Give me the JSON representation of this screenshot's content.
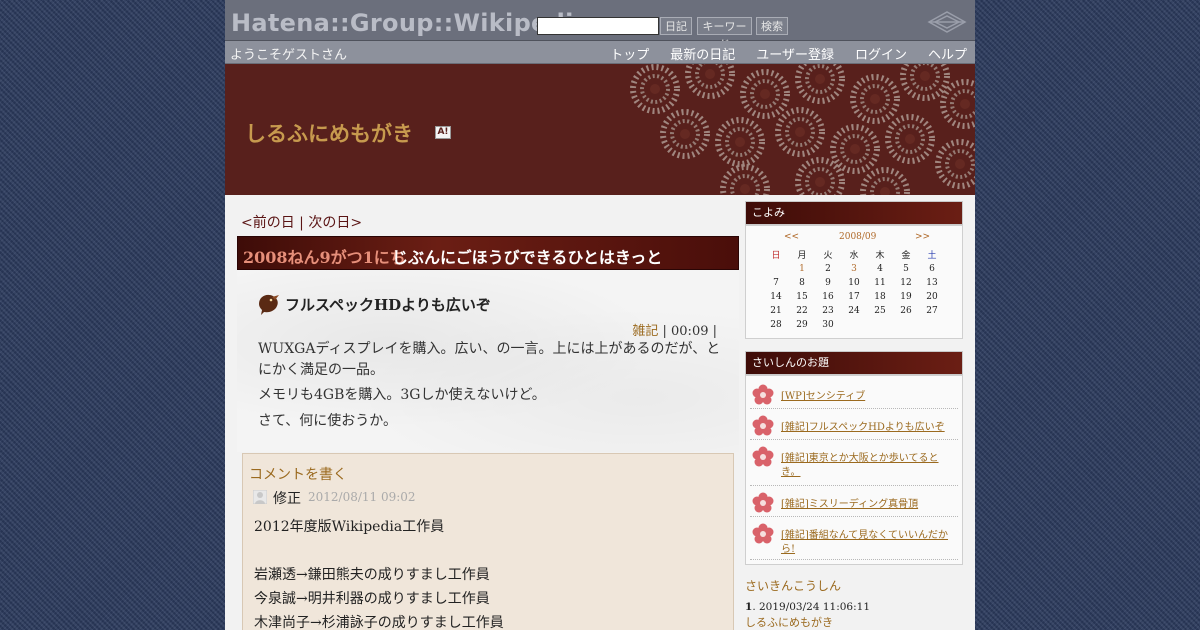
{
  "hatena": {
    "logo": "Hatena::Group::Wikipedia",
    "search_value": "",
    "btn_diary": "日記",
    "btn_keyword": "キーワード",
    "btn_search": "検索"
  },
  "nav": {
    "welcome": "ようこそゲストさん",
    "links": [
      "トップ",
      "最新の日記",
      "ユーザー登録",
      "ログイン",
      "ヘルプ"
    ]
  },
  "blog": {
    "title": "しるふにめもがき",
    "badge": "A!"
  },
  "daynav": {
    "prev": "<前の日",
    "sep": " | ",
    "next": "次の日>"
  },
  "day": {
    "date": "2008ねん9がつ1にち",
    "title": "じぶんにごほうびできるひとはきっと"
  },
  "section": {
    "title": "フルスペックHDよりも広いぞ",
    "category": "雑記",
    "time": " | 00:09 |",
    "paragraphs": [
      "WUXGAディスプレイを購入。広い、の一言。上には上があるのだが、とにかく満足の一品。",
      "メモリも4GBを購入。3Gしか使えないけど。",
      "さて、何に使おうか。"
    ]
  },
  "comments": {
    "write_label": "コメントを書く",
    "author": "修正",
    "time": "2012/08/11 09:02",
    "lines": [
      "2012年度版Wikipedia工作員",
      "岩瀬透→鎌田熊夫の成りすまし工作員",
      "今泉誠→明井利器の成りすまし工作員",
      "木津尚子→杉浦詠子の成りすまし工作員"
    ]
  },
  "calendar": {
    "heading": "こよみ",
    "prev": "<<",
    "month": "2008/09",
    "next": ">>",
    "weekdays": [
      "日",
      "月",
      "火",
      "水",
      "木",
      "金",
      "土"
    ],
    "weeks": [
      [
        "",
        "1",
        "2",
        "3",
        "4",
        "5",
        "6"
      ],
      [
        "7",
        "8",
        "9",
        "10",
        "11",
        "12",
        "13"
      ],
      [
        "14",
        "15",
        "16",
        "17",
        "18",
        "19",
        "20"
      ],
      [
        "21",
        "22",
        "23",
        "24",
        "25",
        "26",
        "27"
      ],
      [
        "28",
        "29",
        "30",
        "",
        "",
        "",
        ""
      ]
    ],
    "linked_days": [
      "1",
      "3"
    ]
  },
  "recent": {
    "heading": "さいしんのお題",
    "items": [
      "[WP]センシティブ",
      "[雑記]フルスペックHDよりも広いぞ",
      "[雑記]東京とか大阪とか歩いてるとき。",
      "[雑記]ミスリーディング真骨頂",
      "[雑記]番組なんて見なくていいんだから!"
    ]
  },
  "recent_comments": {
    "heading": "さいきんこうしん",
    "index": "1",
    "timestamp": ". 2019/03/24 11:06:11",
    "blog": "しるふにめもがき"
  },
  "colors": {
    "banner": "#58201c",
    "accent_gold": "#c79a4e",
    "link_brown": "#9b6a1f"
  }
}
